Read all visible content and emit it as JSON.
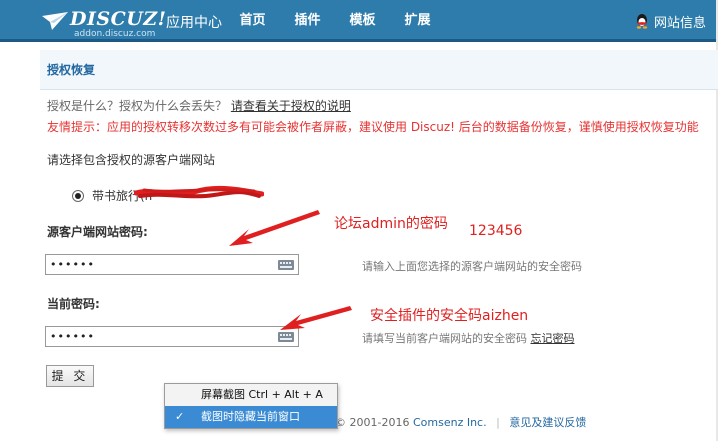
{
  "header": {
    "logo_text": "DISCUZ!",
    "logo_cn": "应用中心",
    "logo_sub": "addon.discuz.com",
    "nav": [
      "首页",
      "插件",
      "模板",
      "扩展"
    ],
    "site_info": "网站信息"
  },
  "section": {
    "title": "授权恢复",
    "tip_question": "授权是什么？授权为什么会丢失？",
    "tip_link": "请查看关于授权的说明",
    "tip_warning": "友情提示：应用的授权转移次数过多有可能会被作者屏蔽，建议使用 Discuz! 后台的数据备份恢复，谨慎使用授权恢复功能",
    "choose_label": "请选择包含授权的源客户端网站",
    "radio_label": "带书旅行(h",
    "source_pw_label": "源客户端网站密码:",
    "source_pw_value": "••••••",
    "source_pw_hint": "请输入上面您选择的源客户端网站的安全密码",
    "current_pw_label": "当前密码:",
    "current_pw_value": "••••••",
    "current_pw_hint": "请填写当前客户端网站的安全密码",
    "forgot_link": "忘记密码",
    "submit_label": "提 交"
  },
  "annotations": {
    "note1": "论坛admin的密码",
    "note1_value": "123456",
    "note2": "安全插件的安全码aizhen"
  },
  "context_menu": {
    "items": [
      {
        "label": "屏幕截图 Ctrl + Alt + A",
        "active": false,
        "checked": false
      },
      {
        "label": "截图时隐藏当前窗口",
        "active": true,
        "checked": true
      }
    ],
    "check_mark": "✓"
  },
  "footer": {
    "copyright": "© 2001-2016",
    "brand": "Comsenz Inc.",
    "separator": "|",
    "feedback": "意见及建议反馈"
  },
  "colors": {
    "header_bg": "#2e7cab",
    "link_blue": "#2468a2",
    "warning_red": "#e63333",
    "annotation_red": "#e02020",
    "menu_highlight": "#3b8bd4"
  }
}
